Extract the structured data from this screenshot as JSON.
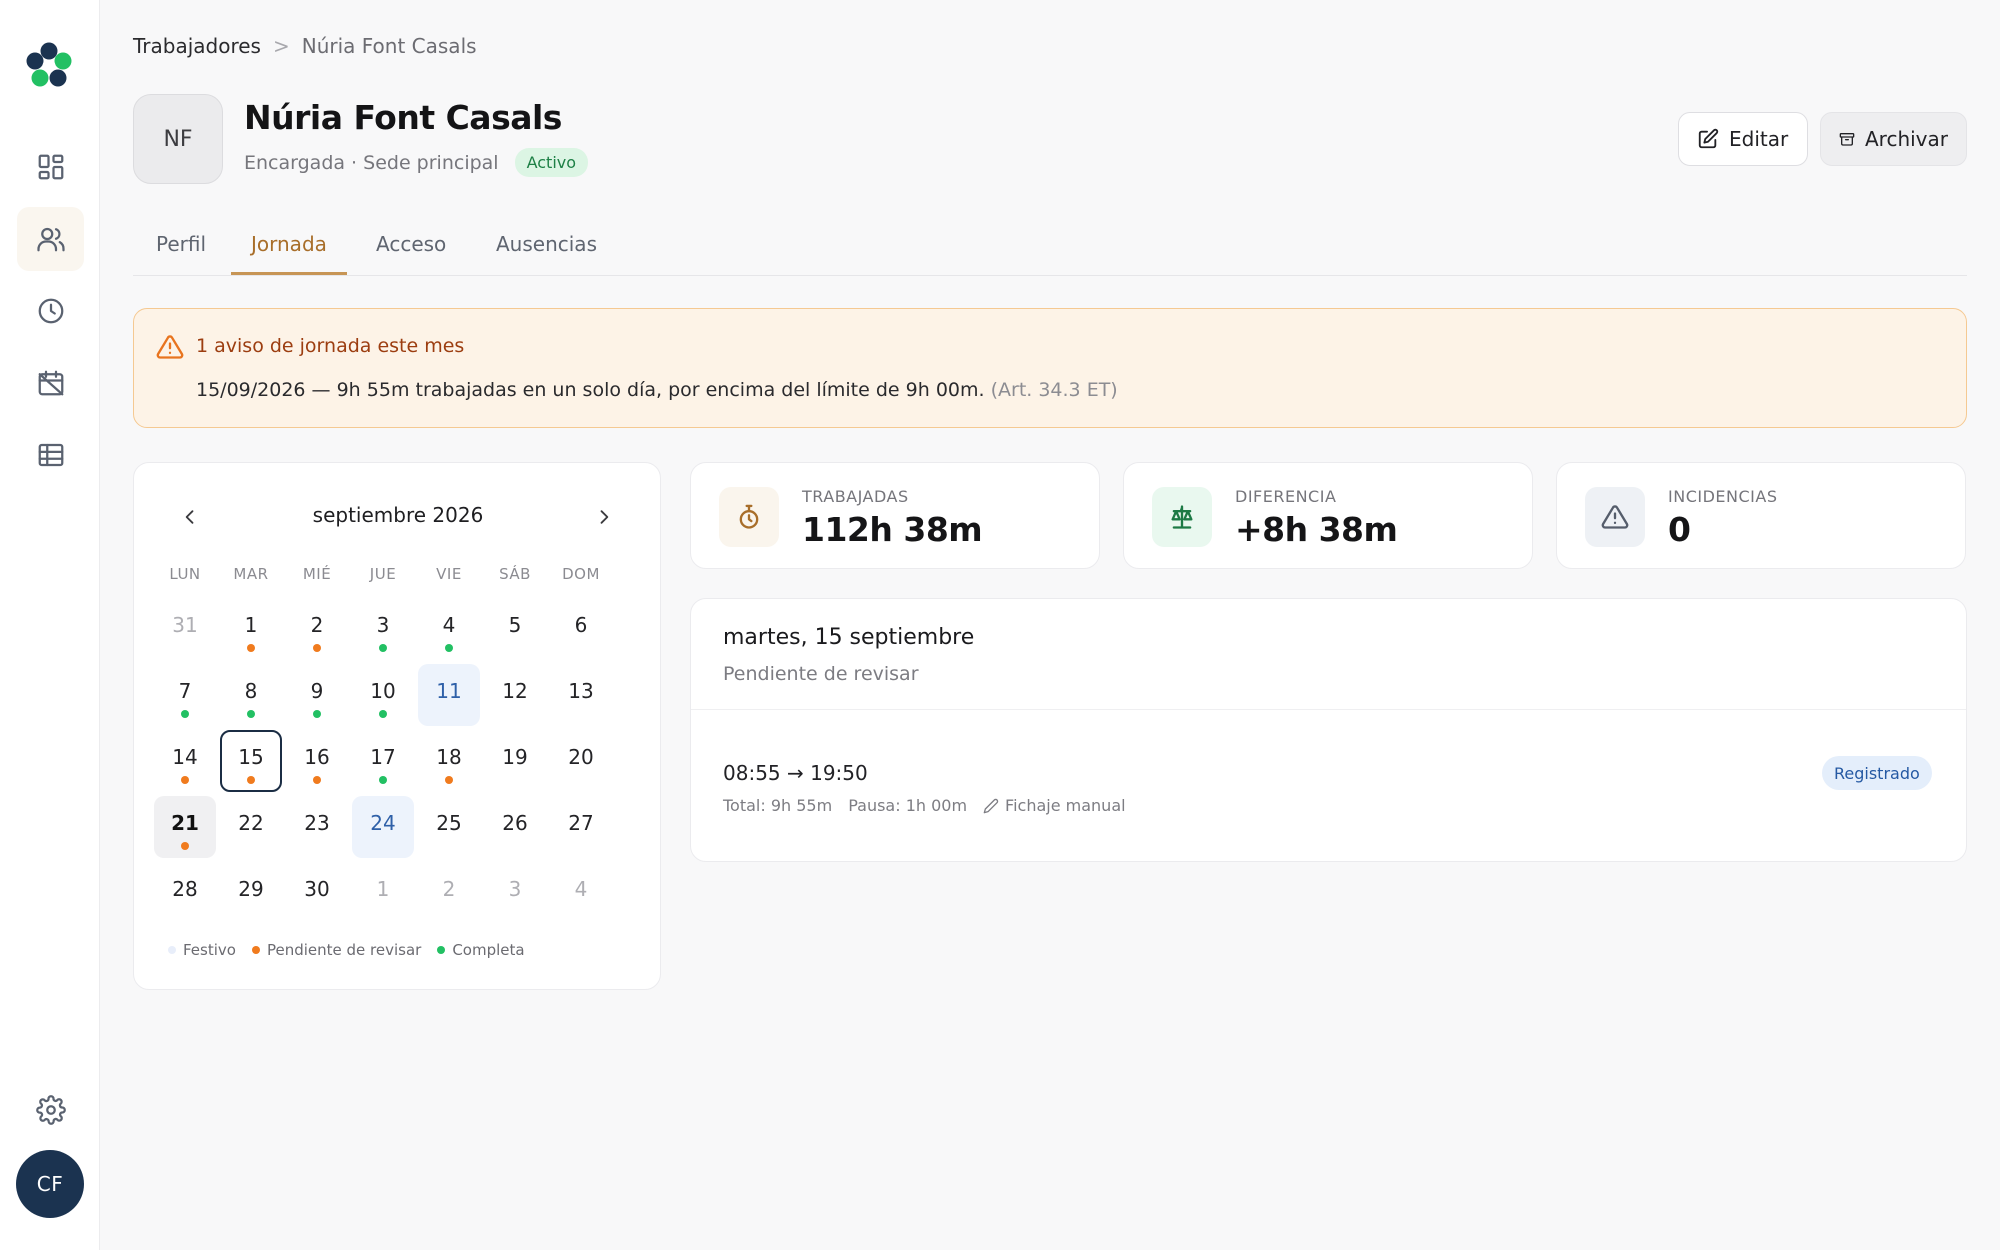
{
  "sidebar": {
    "user_initials": "CF"
  },
  "breadcrumb": {
    "parent": "Trabajadores",
    "separator": ">",
    "current": "Núria Font Casals"
  },
  "profile": {
    "initials": "NF",
    "name": "Núria Font Casals",
    "subtitle": "Encargada · Sede principal",
    "status": "Activo"
  },
  "actions": {
    "edit": "Editar",
    "archive": "Archivar"
  },
  "tabs": [
    {
      "label": "Perfil"
    },
    {
      "label": "Jornada"
    },
    {
      "label": "Acceso"
    },
    {
      "label": "Ausencias"
    }
  ],
  "active_tab": "Jornada",
  "alert": {
    "title": "1 aviso de jornada este mes",
    "date": "15/09/2026",
    "message": " — 9h 55m trabajadas en un solo día, por encima del límite de 9h 00m. ",
    "reference": "(Art. 34.3 ET)"
  },
  "calendar": {
    "month_label": "septiembre 2026",
    "weekdays": [
      "LUN",
      "MAR",
      "MIÉ",
      "JUE",
      "VIE",
      "SÁB",
      "DOM"
    ],
    "days": [
      {
        "d": "31",
        "muted": true,
        "dot": ""
      },
      {
        "d": "1",
        "dot": "orange"
      },
      {
        "d": "2",
        "dot": "orange"
      },
      {
        "d": "3",
        "dot": "green"
      },
      {
        "d": "4",
        "dot": "green"
      },
      {
        "d": "5",
        "dot": ""
      },
      {
        "d": "6",
        "dot": ""
      },
      {
        "d": "7",
        "dot": "green"
      },
      {
        "d": "8",
        "dot": "green"
      },
      {
        "d": "9",
        "dot": "green"
      },
      {
        "d": "10",
        "dot": "green"
      },
      {
        "d": "11",
        "holiday": true,
        "dot": ""
      },
      {
        "d": "12",
        "dot": ""
      },
      {
        "d": "13",
        "dot": ""
      },
      {
        "d": "14",
        "dot": "orange"
      },
      {
        "d": "15",
        "selected": true,
        "dot": "orange"
      },
      {
        "d": "16",
        "dot": "orange"
      },
      {
        "d": "17",
        "dot": "green"
      },
      {
        "d": "18",
        "dot": "orange"
      },
      {
        "d": "19",
        "dot": ""
      },
      {
        "d": "20",
        "dot": ""
      },
      {
        "d": "21",
        "today": true,
        "dot": "orange"
      },
      {
        "d": "22",
        "dot": ""
      },
      {
        "d": "23",
        "dot": ""
      },
      {
        "d": "24",
        "holiday": true,
        "dot": ""
      },
      {
        "d": "25",
        "dot": ""
      },
      {
        "d": "26",
        "dot": ""
      },
      {
        "d": "27",
        "dot": ""
      },
      {
        "d": "28",
        "dot": ""
      },
      {
        "d": "29",
        "dot": ""
      },
      {
        "d": "30",
        "dot": ""
      },
      {
        "d": "1",
        "muted": true,
        "dot": ""
      },
      {
        "d": "2",
        "muted": true,
        "dot": ""
      },
      {
        "d": "3",
        "muted": true,
        "dot": ""
      },
      {
        "d": "4",
        "muted": true,
        "dot": ""
      }
    ],
    "legend": [
      {
        "label": "Festivo",
        "color": "#e8eefa"
      },
      {
        "label": "Pendiente de revisar",
        "color": "#f07b1e"
      },
      {
        "label": "Completa",
        "color": "#22c063"
      }
    ]
  },
  "stats": [
    {
      "label": "TRABAJADAS",
      "value": "112h 38m",
      "icon": "stopwatch-icon",
      "bg": "#faf5ed",
      "color": "#a86e2a"
    },
    {
      "label": "DIFERENCIA",
      "value": "+8h 38m",
      "icon": "scale-icon",
      "bg": "#e9f8ef",
      "color": "#1d7a45"
    },
    {
      "label": "INCIDENCIAS",
      "value": "0",
      "icon": "warning-icon",
      "bg": "#eef1f5",
      "color": "#555d6b"
    }
  ],
  "detail": {
    "date": "martes, 15 septiembre",
    "status": "Pendiente de revisar",
    "entry": {
      "time": "08:55 → 19:50",
      "total": "Total: 9h 55m",
      "pause": "Pausa: 1h 00m",
      "type": "Fichaje manual",
      "badge": "Registrado"
    }
  },
  "colors": {
    "accent": "#c79555",
    "alert_bg": "#fdf3e7",
    "alert_border": "#f5c992",
    "user_avatar": "#1b3350"
  }
}
